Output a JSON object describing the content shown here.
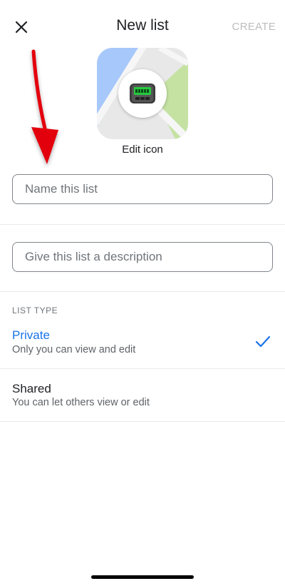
{
  "header": {
    "title": "New list",
    "create_label": "CREATE",
    "close_icon": "close-icon"
  },
  "list_icon": {
    "label": "Edit icon",
    "emoji": "📟"
  },
  "form": {
    "name_placeholder": "Name this list",
    "description_placeholder": "Give this list a description"
  },
  "list_type": {
    "section_label": "LIST TYPE",
    "options": [
      {
        "title": "Private",
        "subtitle": "Only you can view and edit",
        "selected": true
      },
      {
        "title": "Shared",
        "subtitle": "You can let others view or edit",
        "selected": false
      }
    ]
  },
  "colors": {
    "accent": "#1a73e8",
    "disabled": "#bdbdbd",
    "annotation_arrow": "#e3000f",
    "map_blue": "#a7c8fa",
    "map_green": "#c5e2a3",
    "map_road": "#e8e8e8"
  }
}
